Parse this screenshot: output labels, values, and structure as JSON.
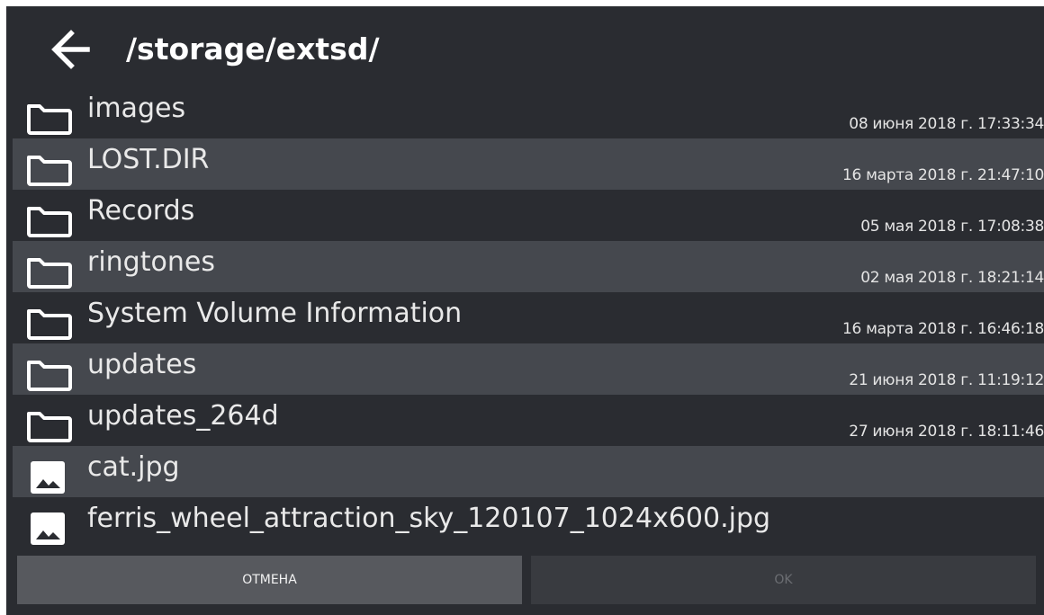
{
  "header": {
    "path": "/storage/extsd/",
    "back_icon": "arrow-left-icon"
  },
  "files": [
    {
      "name": "images",
      "date": "08 июня 2018 г. 17:33:34",
      "type": "folder",
      "icon": "folder-icon"
    },
    {
      "name": "LOST.DIR",
      "date": "16 марта 2018 г. 21:47:10",
      "type": "folder",
      "icon": "folder-icon"
    },
    {
      "name": "Records",
      "date": "05 мая 2018 г. 17:08:38",
      "type": "folder",
      "icon": "folder-icon"
    },
    {
      "name": "ringtones",
      "date": "02 мая 2018 г. 18:21:14",
      "type": "folder",
      "icon": "folder-icon"
    },
    {
      "name": "System Volume Information",
      "date": "16 марта 2018 г. 16:46:18",
      "type": "folder",
      "icon": "folder-icon"
    },
    {
      "name": "updates",
      "date": "21 июня 2018 г. 11:19:12",
      "type": "folder",
      "icon": "folder-icon"
    },
    {
      "name": "updates_264d",
      "date": "27 июня 2018 г. 18:11:46",
      "type": "folder",
      "icon": "folder-icon"
    },
    {
      "name": "cat.jpg",
      "date": "",
      "type": "image",
      "icon": "image-icon"
    },
    {
      "name": "ferris_wheel_attraction_sky_120107_1024x600.jpg",
      "date": "",
      "type": "image",
      "icon": "image-icon"
    }
  ],
  "buttons": {
    "cancel_label": "ОТМЕНА",
    "ok_label": "OK"
  },
  "colors": {
    "background": "#2a2c31",
    "row_alt": "#45484e",
    "cancel_bg": "#57595e",
    "ok_bg": "#393b40",
    "ok_text_disabled": "#6c6e73"
  }
}
